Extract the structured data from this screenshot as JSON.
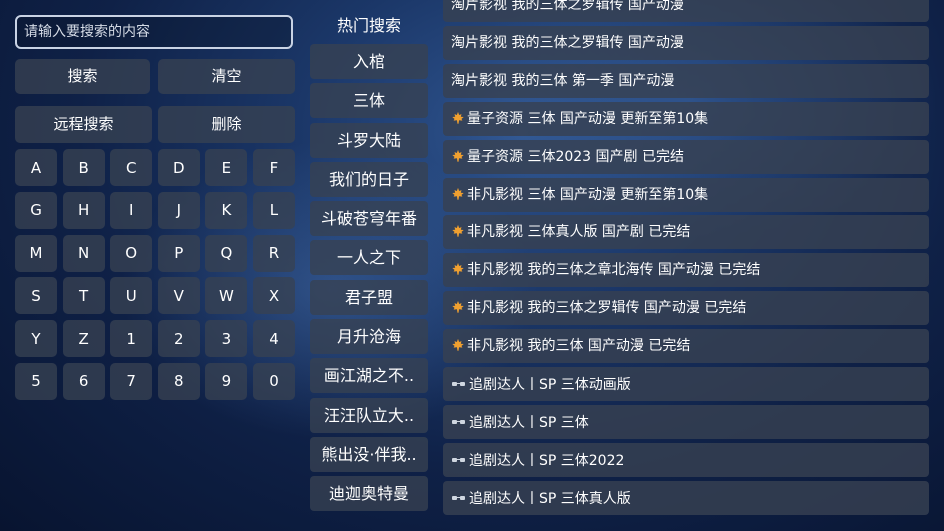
{
  "search": {
    "placeholder": "请输入要搜索的内容"
  },
  "actions": {
    "search": "搜索",
    "clear": "清空",
    "remote_search": "远程搜索",
    "delete": "删除"
  },
  "keyboard": [
    "A",
    "B",
    "C",
    "D",
    "E",
    "F",
    "G",
    "H",
    "I",
    "J",
    "K",
    "L",
    "M",
    "N",
    "O",
    "P",
    "Q",
    "R",
    "S",
    "T",
    "U",
    "V",
    "W",
    "X",
    "Y",
    "Z",
    "1",
    "2",
    "3",
    "4",
    "5",
    "6",
    "7",
    "8",
    "9",
    "0"
  ],
  "hot": {
    "title": "热门搜索",
    "items": [
      "入棺",
      "三体",
      "斗罗大陆",
      "我们的日子",
      "斗破苍穹年番",
      "一人之下",
      "君子盟",
      "月升沧海",
      "画江湖之不..",
      "汪汪队立大..",
      "熊出没·伴我..",
      "迪迦奥特曼"
    ]
  },
  "results": [
    {
      "icon": "none",
      "text": "淘片影视  我的三体之罗辑传 国产动漫"
    },
    {
      "icon": "none",
      "text": "淘片影视  我的三体之罗辑传 国产动漫"
    },
    {
      "icon": "none",
      "text": "淘片影视  我的三体 第一季 国产动漫"
    },
    {
      "icon": "maple-leaf-icon",
      "text": "量子资源  三体 国产动漫 更新至第10集"
    },
    {
      "icon": "maple-leaf-icon",
      "text": "量子资源  三体2023 国产剧 已完结"
    },
    {
      "icon": "maple-leaf-icon",
      "text": "非凡影视  三体 国产动漫 更新至第10集"
    },
    {
      "icon": "maple-leaf-icon",
      "text": "非凡影视  三体真人版 国产剧 已完结"
    },
    {
      "icon": "maple-leaf-icon",
      "text": "非凡影视  我的三体之章北海传 国产动漫 已完结"
    },
    {
      "icon": "maple-leaf-icon",
      "text": "非凡影视  我的三体之罗辑传 国产动漫 已完结"
    },
    {
      "icon": "maple-leaf-icon",
      "text": "非凡影视  我的三体 国产动漫 已完结"
    },
    {
      "icon": "glasses-icon",
      "text": "追剧达人丨SP  三体动画版"
    },
    {
      "icon": "glasses-icon",
      "text": "追剧达人丨SP  三体"
    },
    {
      "icon": "glasses-icon",
      "text": "追剧达人丨SP  三体2022"
    },
    {
      "icon": "glasses-icon",
      "text": "追剧达人丨SP  三体真人版"
    }
  ],
  "colors": {
    "leaf": "#f0a030",
    "panel": "#374152",
    "border": "#c9d3e4"
  }
}
